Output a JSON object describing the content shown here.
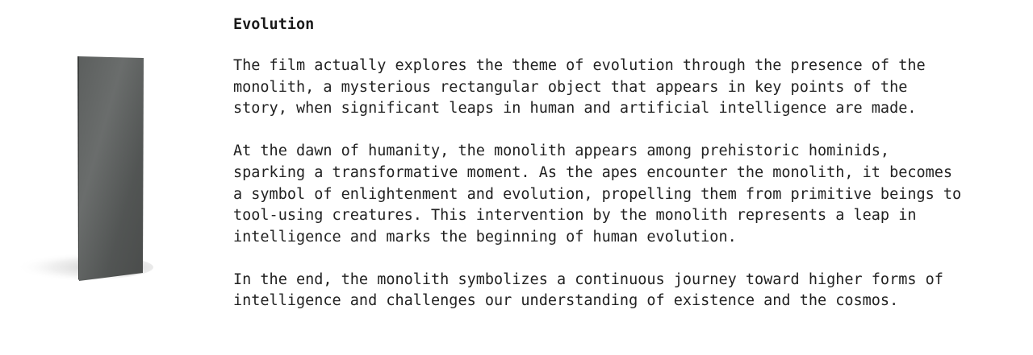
{
  "article": {
    "title": "Evolution",
    "paragraphs": [
      [
        "The film actually explores the theme of evolution through the presence of the",
        "monolith, a mysterious rectangular object that appears in key points of the",
        "story, when significant leaps in human and artificial intelligence are made."
      ],
      [
        "At the dawn of humanity, the monolith appears among prehistoric hominids,",
        "sparking a transformative moment. As the apes encounter the monolith, it becomes",
        "a symbol of enlightenment and evolution, propelling them from primitive beings to",
        "tool-using creatures. This intervention by the monolith represents a leap in",
        "intelligence and marks the beginning of human evolution."
      ],
      [
        "In the end, the monolith symbolizes a continuous journey toward higher forms of",
        "intelligence and challenges our understanding of existence and the cosmos."
      ]
    ]
  },
  "colors": {
    "monolith_face": "#575a59",
    "monolith_edge": "#3c3e3d",
    "text": "#222222"
  }
}
